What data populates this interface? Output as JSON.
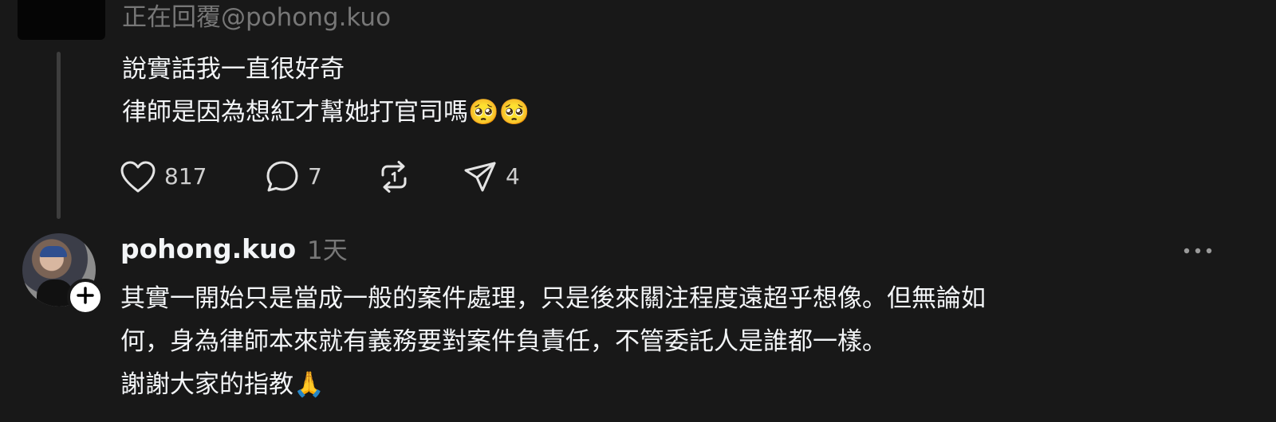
{
  "parent_post": {
    "reply_to": "正在回覆@pohong.kuo",
    "lines": [
      "說實話我一直很好奇",
      "律師是因為想紅才幫她打官司嗎🥺🥺"
    ],
    "actions": {
      "like_count": "817",
      "comment_count": "7",
      "share_count": "4"
    }
  },
  "reply": {
    "username": "pohong.kuo",
    "time": "1天",
    "lines": [
      "其實一開始只是當成一般的案件處理，只是後來關注程度遠超乎想像。但無論如",
      "何，身為律師本來就有義務要對案件負責任，不管委託人是誰都一樣。",
      "謝謝大家的指教🙏"
    ]
  },
  "icons": {
    "like": "heart-icon",
    "comment": "comment-bubble-icon",
    "repost": "repost-icon",
    "share": "send-icon",
    "more": "more-dots-icon",
    "follow": "plus-icon"
  },
  "colors": {
    "background": "#181818",
    "primary_text": "#f3f5f7",
    "secondary_text": "#777777",
    "thread_line": "#3d3d3d"
  }
}
